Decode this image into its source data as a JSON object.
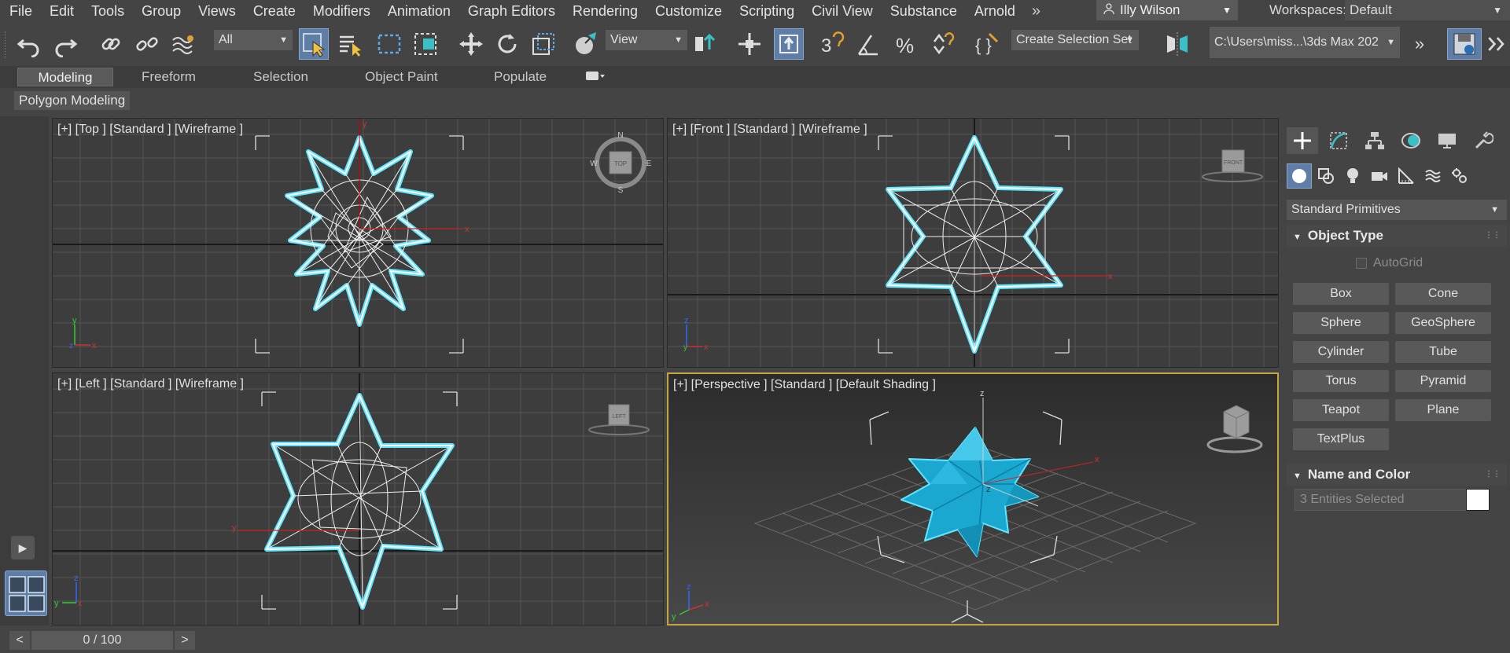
{
  "menu": [
    "File",
    "Edit",
    "Tools",
    "Group",
    "Views",
    "Create",
    "Modifiers",
    "Animation",
    "Graph Editors",
    "Rendering",
    "Customize",
    "Scripting",
    "Civil View",
    "Substance",
    "Arnold"
  ],
  "menu_more": "»",
  "user": {
    "name": "Illy Wilson",
    "icon": "user-icon"
  },
  "workspace": {
    "label": "Workspaces:",
    "value": "Default"
  },
  "toolbar": {
    "selection_filter": "All",
    "ref_coord": "View",
    "named_selection": "Create Selection Set",
    "project_path": "C:\\Users\\miss...\\3ds Max 202",
    "more": "»"
  },
  "ribbon": {
    "tabs": [
      "Modeling",
      "Freeform",
      "Selection",
      "Object Paint",
      "Populate"
    ],
    "active_tab": "Modeling",
    "sub_label": "Polygon Modeling"
  },
  "viewports": {
    "top": {
      "label": "[+] [Top ] [Standard ] [Wireframe ]",
      "cube": "TOP",
      "compass": [
        "N",
        "S",
        "E",
        "W"
      ]
    },
    "front": {
      "label": "[+] [Front ] [Standard ] [Wireframe ]",
      "cube": "FRONT"
    },
    "left": {
      "label": "[+] [Left ] [Standard ] [Wireframe ]",
      "cube": "LEFT"
    },
    "perspective": {
      "label": "[+] [Perspective ] [Standard ] [Default Shading ]"
    },
    "accent_color": "#c5a540",
    "object_color": "#1ab3d9",
    "highlight_color": "#5ee6ff"
  },
  "command_panel": {
    "tabs": [
      "create-icon",
      "modify-icon",
      "hierarchy-icon",
      "motion-icon",
      "display-icon",
      "utilities-icon"
    ],
    "subtabs": [
      "geometry-icon",
      "shapes-icon",
      "lights-icon",
      "cameras-icon",
      "helpers-icon",
      "spacewarps-icon",
      "systems-icon"
    ],
    "category": "Standard Primitives",
    "object_type_title": "Object Type",
    "autogrid": "AutoGrid",
    "buttons": [
      "Box",
      "Cone",
      "Sphere",
      "GeoSphere",
      "Cylinder",
      "Tube",
      "Torus",
      "Pyramid",
      "Teapot",
      "Plane",
      "TextPlus"
    ],
    "name_color_title": "Name and Color",
    "name_value": "3 Entities Selected",
    "swatch_color": "#ffffff"
  },
  "timeline": {
    "frame": "0 / 100",
    "prev": "<",
    "next": ">"
  }
}
